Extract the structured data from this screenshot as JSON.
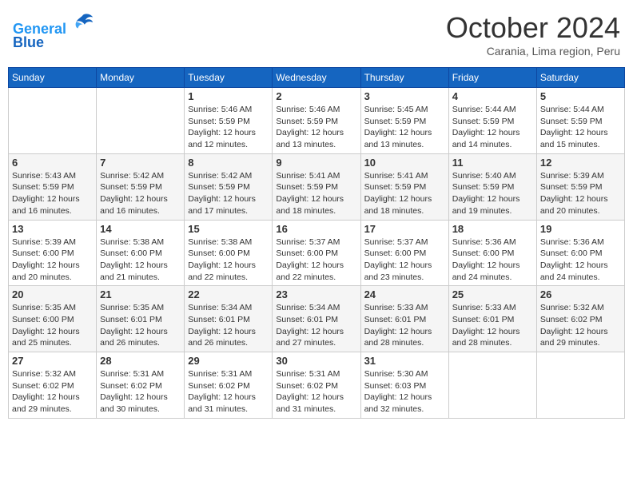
{
  "header": {
    "logo_line1": "General",
    "logo_line2": "Blue",
    "month": "October 2024",
    "location": "Carania, Lima region, Peru"
  },
  "days_of_week": [
    "Sunday",
    "Monday",
    "Tuesday",
    "Wednesday",
    "Thursday",
    "Friday",
    "Saturday"
  ],
  "weeks": [
    [
      {
        "day": "",
        "info": ""
      },
      {
        "day": "",
        "info": ""
      },
      {
        "day": "1",
        "info": "Sunrise: 5:46 AM\nSunset: 5:59 PM\nDaylight: 12 hours and 12 minutes."
      },
      {
        "day": "2",
        "info": "Sunrise: 5:46 AM\nSunset: 5:59 PM\nDaylight: 12 hours and 13 minutes."
      },
      {
        "day": "3",
        "info": "Sunrise: 5:45 AM\nSunset: 5:59 PM\nDaylight: 12 hours and 13 minutes."
      },
      {
        "day": "4",
        "info": "Sunrise: 5:44 AM\nSunset: 5:59 PM\nDaylight: 12 hours and 14 minutes."
      },
      {
        "day": "5",
        "info": "Sunrise: 5:44 AM\nSunset: 5:59 PM\nDaylight: 12 hours and 15 minutes."
      }
    ],
    [
      {
        "day": "6",
        "info": "Sunrise: 5:43 AM\nSunset: 5:59 PM\nDaylight: 12 hours and 16 minutes."
      },
      {
        "day": "7",
        "info": "Sunrise: 5:42 AM\nSunset: 5:59 PM\nDaylight: 12 hours and 16 minutes."
      },
      {
        "day": "8",
        "info": "Sunrise: 5:42 AM\nSunset: 5:59 PM\nDaylight: 12 hours and 17 minutes."
      },
      {
        "day": "9",
        "info": "Sunrise: 5:41 AM\nSunset: 5:59 PM\nDaylight: 12 hours and 18 minutes."
      },
      {
        "day": "10",
        "info": "Sunrise: 5:41 AM\nSunset: 5:59 PM\nDaylight: 12 hours and 18 minutes."
      },
      {
        "day": "11",
        "info": "Sunrise: 5:40 AM\nSunset: 5:59 PM\nDaylight: 12 hours and 19 minutes."
      },
      {
        "day": "12",
        "info": "Sunrise: 5:39 AM\nSunset: 5:59 PM\nDaylight: 12 hours and 20 minutes."
      }
    ],
    [
      {
        "day": "13",
        "info": "Sunrise: 5:39 AM\nSunset: 6:00 PM\nDaylight: 12 hours and 20 minutes."
      },
      {
        "day": "14",
        "info": "Sunrise: 5:38 AM\nSunset: 6:00 PM\nDaylight: 12 hours and 21 minutes."
      },
      {
        "day": "15",
        "info": "Sunrise: 5:38 AM\nSunset: 6:00 PM\nDaylight: 12 hours and 22 minutes."
      },
      {
        "day": "16",
        "info": "Sunrise: 5:37 AM\nSunset: 6:00 PM\nDaylight: 12 hours and 22 minutes."
      },
      {
        "day": "17",
        "info": "Sunrise: 5:37 AM\nSunset: 6:00 PM\nDaylight: 12 hours and 23 minutes."
      },
      {
        "day": "18",
        "info": "Sunrise: 5:36 AM\nSunset: 6:00 PM\nDaylight: 12 hours and 24 minutes."
      },
      {
        "day": "19",
        "info": "Sunrise: 5:36 AM\nSunset: 6:00 PM\nDaylight: 12 hours and 24 minutes."
      }
    ],
    [
      {
        "day": "20",
        "info": "Sunrise: 5:35 AM\nSunset: 6:00 PM\nDaylight: 12 hours and 25 minutes."
      },
      {
        "day": "21",
        "info": "Sunrise: 5:35 AM\nSunset: 6:01 PM\nDaylight: 12 hours and 26 minutes."
      },
      {
        "day": "22",
        "info": "Sunrise: 5:34 AM\nSunset: 6:01 PM\nDaylight: 12 hours and 26 minutes."
      },
      {
        "day": "23",
        "info": "Sunrise: 5:34 AM\nSunset: 6:01 PM\nDaylight: 12 hours and 27 minutes."
      },
      {
        "day": "24",
        "info": "Sunrise: 5:33 AM\nSunset: 6:01 PM\nDaylight: 12 hours and 28 minutes."
      },
      {
        "day": "25",
        "info": "Sunrise: 5:33 AM\nSunset: 6:01 PM\nDaylight: 12 hours and 28 minutes."
      },
      {
        "day": "26",
        "info": "Sunrise: 5:32 AM\nSunset: 6:02 PM\nDaylight: 12 hours and 29 minutes."
      }
    ],
    [
      {
        "day": "27",
        "info": "Sunrise: 5:32 AM\nSunset: 6:02 PM\nDaylight: 12 hours and 29 minutes."
      },
      {
        "day": "28",
        "info": "Sunrise: 5:31 AM\nSunset: 6:02 PM\nDaylight: 12 hours and 30 minutes."
      },
      {
        "day": "29",
        "info": "Sunrise: 5:31 AM\nSunset: 6:02 PM\nDaylight: 12 hours and 31 minutes."
      },
      {
        "day": "30",
        "info": "Sunrise: 5:31 AM\nSunset: 6:02 PM\nDaylight: 12 hours and 31 minutes."
      },
      {
        "day": "31",
        "info": "Sunrise: 5:30 AM\nSunset: 6:03 PM\nDaylight: 12 hours and 32 minutes."
      },
      {
        "day": "",
        "info": ""
      },
      {
        "day": "",
        "info": ""
      }
    ]
  ]
}
